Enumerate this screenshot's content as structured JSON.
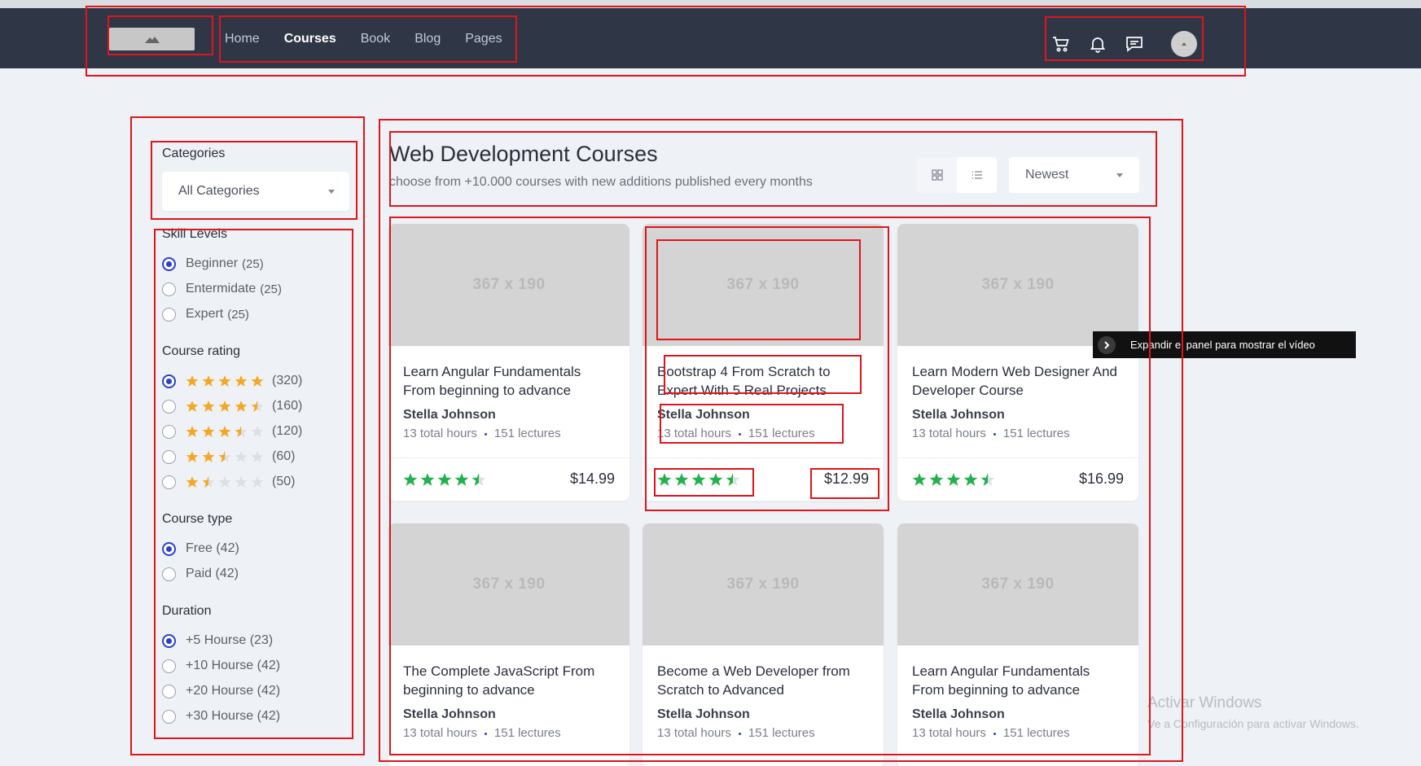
{
  "nav": {
    "links": [
      "Home",
      "Courses",
      "Book",
      "Blog",
      "Pages"
    ],
    "active": "Courses",
    "icons": [
      "cart-icon",
      "bell-icon",
      "chat-icon",
      "avatar"
    ]
  },
  "filters": {
    "categories_label": "Categories",
    "categories_value": "All Categories",
    "skill_label": "Skill Levels",
    "skills": [
      {
        "label": "Beginner",
        "count": "(25)",
        "checked": true
      },
      {
        "label": "Entermidate",
        "count": "(25)",
        "checked": false
      },
      {
        "label": "Expert",
        "count": "(25)",
        "checked": false
      }
    ],
    "rating_label": "Course rating",
    "ratings": [
      {
        "stars": 5,
        "count": "(320)",
        "checked": true
      },
      {
        "stars": 4.5,
        "count": "(160)",
        "checked": false
      },
      {
        "stars": 3.5,
        "count": "(120)",
        "checked": false
      },
      {
        "stars": 2.5,
        "count": "(60)",
        "checked": false
      },
      {
        "stars": 1.5,
        "count": "(50)",
        "checked": false
      }
    ],
    "type_label": "Course type",
    "types": [
      {
        "label": "Free (42)",
        "checked": true
      },
      {
        "label": "Paid (42)",
        "checked": false
      }
    ],
    "duration_label": "Duration",
    "durations": [
      {
        "label": "+5 Hourse (23)",
        "checked": true
      },
      {
        "label": "+10 Hourse (42)",
        "checked": false
      },
      {
        "label": "+20 Hourse (42)",
        "checked": false
      },
      {
        "label": "+30 Hourse (42)",
        "checked": false
      }
    ]
  },
  "main": {
    "title": "Web Development Courses",
    "subtitle": "choose from +10.000 courses with new additions published every months",
    "sort": "Newest",
    "thumb_text": "367 x 190",
    "courses": [
      {
        "title": "Learn Angular Fundamentals From beginning to advance",
        "author": "Stella Johnson",
        "hours": "13 total hours",
        "lectures": "151 lectures",
        "rating": 4.5,
        "price": "$14.99"
      },
      {
        "title": "Bootstrap 4 From Scratch to Expert With 5 Real Projects",
        "author": "Stella Johnson",
        "hours": "13 total hours",
        "lectures": "151 lectures",
        "rating": 4.5,
        "price": "$12.99"
      },
      {
        "title": "Learn Modern Web Designer And Developer Course",
        "author": "Stella Johnson",
        "hours": "13 total hours",
        "lectures": "151 lectures",
        "rating": 4.5,
        "price": "$16.99"
      },
      {
        "title": "The Complete JavaScript From beginning to advance",
        "author": "Stella Johnson",
        "hours": "13 total hours",
        "lectures": "151 lectures"
      },
      {
        "title": "Become a Web Developer from Scratch to Advanced",
        "author": "Stella Johnson",
        "hours": "13 total hours",
        "lectures": "151 lectures"
      },
      {
        "title": "Learn Angular Fundamentals From beginning to advance",
        "author": "Stella Johnson",
        "hours": "13 total hours",
        "lectures": "151 lectures"
      }
    ]
  },
  "tooltip": "Expandir el panel para mostrar el vídeo",
  "watermark": {
    "line1": "Activar Windows",
    "line2": "Ve a Configuración para activar Windows."
  },
  "colors": {
    "navbar": "#2f3747",
    "accent": "#2b40cf",
    "star_orange": "#f5a623",
    "star_green": "#22b14c",
    "annotation": "#e0141b"
  }
}
